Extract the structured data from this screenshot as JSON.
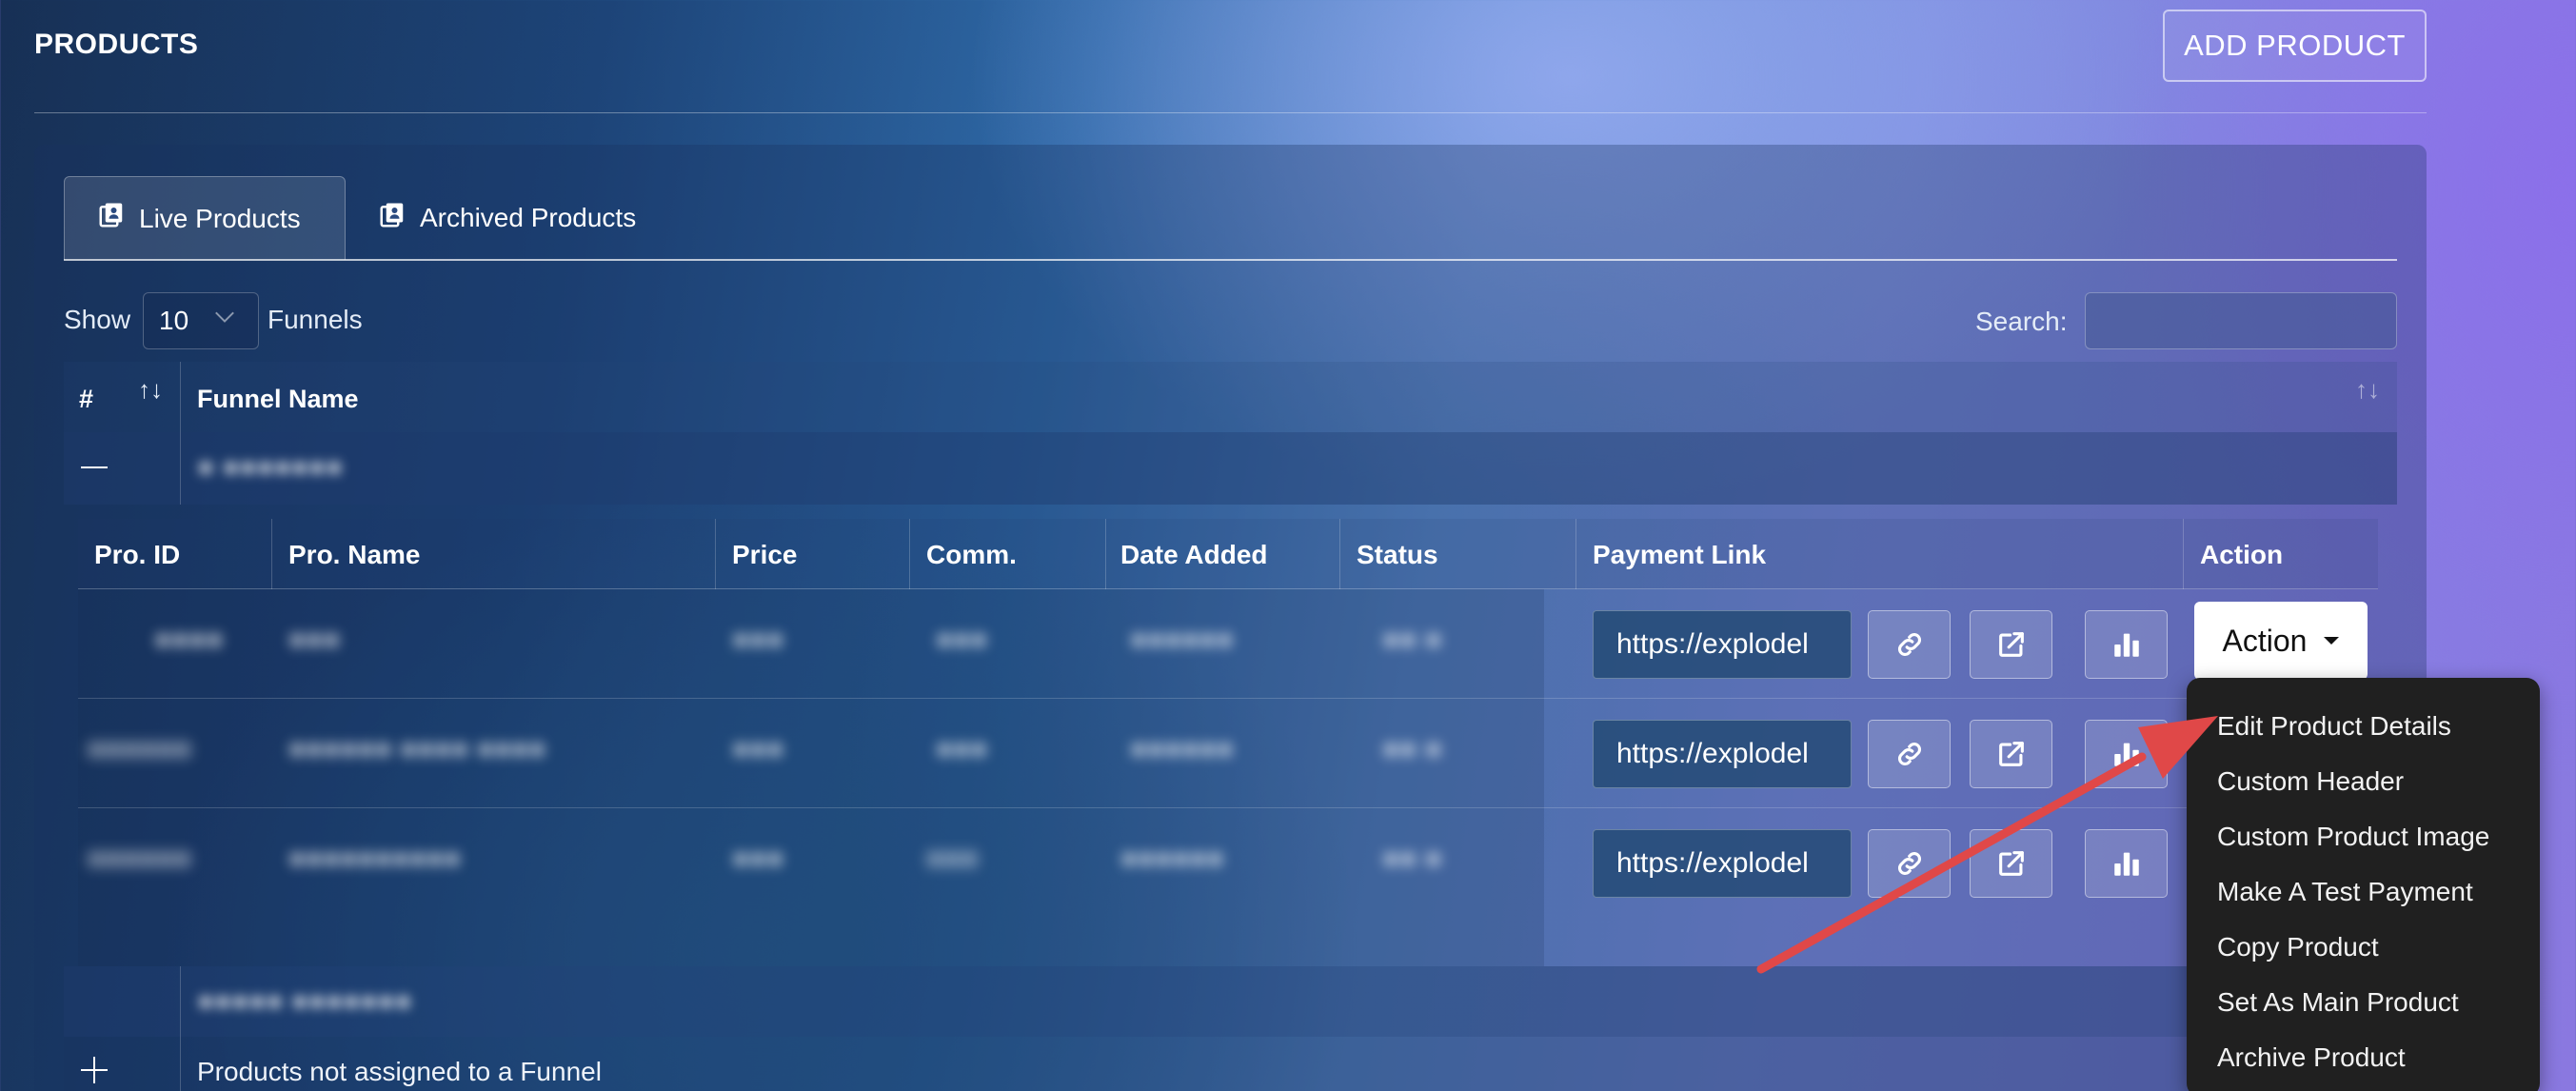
{
  "header": {
    "title": "PRODUCTS",
    "add_button": "ADD PRODUCT"
  },
  "tabs": [
    {
      "label": "Live Products",
      "icon": "contact-book-icon",
      "active": true
    },
    {
      "label": "Archived Products",
      "icon": "contact-book-icon",
      "active": false
    }
  ],
  "controls": {
    "show_label": "Show",
    "page_size": "10",
    "funnels_label": "Funnels",
    "search_label": "Search:",
    "search_value": ""
  },
  "outer_table": {
    "headers": [
      "#",
      "Funnel Name"
    ],
    "group1_name": "●  ●●●●●●●",
    "group2_name": "●●●●●  ●●●●●●●",
    "unassigned_label": "Products not assigned to a Funnel"
  },
  "inner_table": {
    "headers": [
      "Pro. ID",
      "Pro. Name",
      "Price",
      "Comm.",
      "Date Added",
      "Status",
      "Payment Link",
      "Action"
    ],
    "rows": [
      {
        "id": "●●●●",
        "name": "●●●",
        "price": "●●●",
        "comm": "●●●",
        "date": "●●●●●●",
        "status": "●● ●",
        "payment_link": "https://explodel"
      },
      {
        "id": "●●●●●●",
        "name": "●●●●●● ●●●● ●●●●",
        "price": "●●●",
        "comm": "●●●",
        "date": "●●●●●●",
        "status": "●● ●",
        "payment_link": "https://explodel"
      },
      {
        "id": "●●●●●●",
        "name": "●●●●●●●●●●",
        "price": "●●●",
        "comm": "●●●",
        "date": "●●●●●●",
        "status": "●● ●",
        "payment_link": "https://explodel"
      }
    ]
  },
  "action": {
    "button_label": "Action",
    "menu": [
      "Edit Product Details",
      "Custom Header",
      "Custom Product Image",
      "Make A Test Payment",
      "Copy Product",
      "Set As Main Product",
      "Archive Product"
    ]
  },
  "colors": {
    "annotation_arrow": "#e04848",
    "menu_background": "#202020"
  }
}
